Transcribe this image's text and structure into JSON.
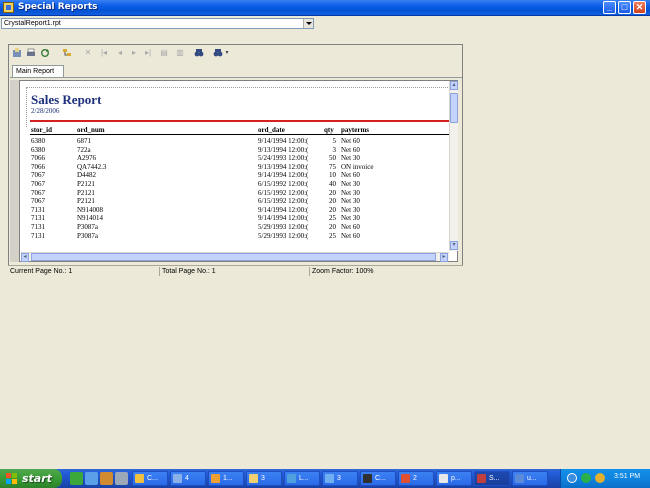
{
  "window": {
    "title": "Special Reports",
    "report_selector_value": "CrystalReport1.rpt"
  },
  "viewer": {
    "tab_label": "Main Report"
  },
  "report": {
    "title": "Sales Report",
    "date": "2/28/2006",
    "columns": [
      "stor_id",
      "ord_num",
      "ord_date",
      "qty",
      "payterms"
    ],
    "rows": [
      [
        "6380",
        "6871",
        "9/14/1994 12:00:(",
        "5",
        "Net 60"
      ],
      [
        "6380",
        "722a",
        "9/13/1994 12:00:(",
        "3",
        "Net 60"
      ],
      [
        "7066",
        "A2976",
        "5/24/1993 12:00:(",
        "50",
        "Net 30"
      ],
      [
        "7066",
        "QA7442.3",
        "9/13/1994 12:00:(",
        "75",
        "ON invoice"
      ],
      [
        "7067",
        "D4482",
        "9/14/1994 12:00:(",
        "10",
        "Net 60"
      ],
      [
        "7067",
        "P2121",
        "6/15/1992 12:00:(",
        "40",
        "Net 30"
      ],
      [
        "7067",
        "P2121",
        "6/15/1992 12:00:(",
        "20",
        "Net 30"
      ],
      [
        "7067",
        "P2121",
        "6/15/1992 12:00:(",
        "20",
        "Net 30"
      ],
      [
        "7131",
        "N914008",
        "9/14/1994 12:00:(",
        "20",
        "Net 30"
      ],
      [
        "7131",
        "N914014",
        "9/14/1994 12:00:(",
        "25",
        "Net 30"
      ],
      [
        "7131",
        "P3087a",
        "5/29/1993 12:00:(",
        "20",
        "Net 60"
      ],
      [
        "7131",
        "P3087a",
        "5/29/1993 12:00:(",
        "25",
        "Net 60"
      ]
    ]
  },
  "status": {
    "current_page": "Current Page No.: 1",
    "total_page": "Total Page No.: 1",
    "zoom": "Zoom Factor: 100%"
  },
  "taskbar": {
    "start_label": "start",
    "tasks": [
      "C...",
      "4",
      "1...",
      "3",
      "L...",
      "3",
      "C...",
      "2",
      "p...",
      "S...",
      "u..."
    ],
    "clock": "3:51 PM"
  }
}
